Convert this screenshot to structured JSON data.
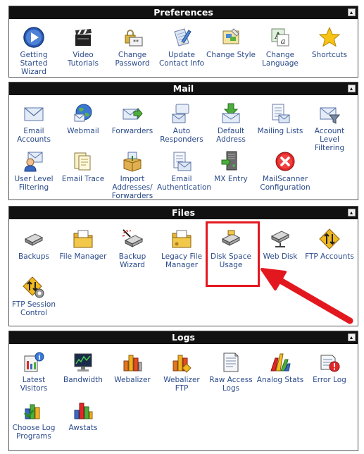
{
  "panels": {
    "preferences": {
      "title": "Preferences",
      "items": [
        {
          "label": "Getting Started Wizard",
          "icon": "play-icon"
        },
        {
          "label": "Video Tutorials",
          "icon": "clapperboard-icon"
        },
        {
          "label": "Change Password",
          "icon": "password-lock-icon"
        },
        {
          "label": "Update Contact Info",
          "icon": "contact-info-icon"
        },
        {
          "label": "Change Style",
          "icon": "style-palette-icon"
        },
        {
          "label": "Change Language",
          "icon": "language-icon"
        },
        {
          "label": "Shortcuts",
          "icon": "star-icon"
        }
      ]
    },
    "mail": {
      "title": "Mail",
      "items": [
        {
          "label": "Email Accounts",
          "icon": "envelope-icon"
        },
        {
          "label": "Webmail",
          "icon": "globe-mail-icon"
        },
        {
          "label": "Forwarders",
          "icon": "forward-mail-icon"
        },
        {
          "label": "Auto Responders",
          "icon": "auto-responder-icon"
        },
        {
          "label": "Default Address",
          "icon": "default-address-icon"
        },
        {
          "label": "Mailing Lists",
          "icon": "mailing-list-icon"
        },
        {
          "label": "Account Level Filtering",
          "icon": "account-filter-icon"
        },
        {
          "label": "User Level Filtering",
          "icon": "user-filter-icon"
        },
        {
          "label": "Email Trace",
          "icon": "email-trace-icon"
        },
        {
          "label": "Import Addresses/ Forwarders",
          "icon": "import-box-icon"
        },
        {
          "label": "Email Authentication",
          "icon": "email-auth-icon"
        },
        {
          "label": "MX Entry",
          "icon": "mx-entry-icon"
        },
        {
          "label": "MailScanner Configuration",
          "icon": "mailscanner-icon"
        }
      ]
    },
    "files": {
      "title": "Files",
      "items": [
        {
          "label": "Backups",
          "icon": "backup-drive-icon"
        },
        {
          "label": "File Manager",
          "icon": "folder-icon"
        },
        {
          "label": "Backup Wizard",
          "icon": "backup-wizard-icon"
        },
        {
          "label": "Legacy File Manager",
          "icon": "legacy-folder-icon"
        },
        {
          "label": "Disk Space Usage",
          "icon": "disk-usage-icon"
        },
        {
          "label": "Web Disk",
          "icon": "web-disk-icon"
        },
        {
          "label": "FTP Accounts",
          "icon": "ftp-accounts-icon"
        },
        {
          "label": "FTP Session Control",
          "icon": "ftp-session-icon"
        }
      ]
    },
    "logs": {
      "title": "Logs",
      "items": [
        {
          "label": "Latest Visitors",
          "icon": "latest-visitors-icon"
        },
        {
          "label": "Bandwidth",
          "icon": "bandwidth-icon"
        },
        {
          "label": "Webalizer",
          "icon": "webalizer-icon"
        },
        {
          "label": "Webalizer FTP",
          "icon": "webalizer-ftp-icon"
        },
        {
          "label": "Raw Access Logs",
          "icon": "raw-logs-icon"
        },
        {
          "label": "Analog Stats",
          "icon": "analog-stats-icon"
        },
        {
          "label": "Error Log",
          "icon": "error-log-icon"
        },
        {
          "label": "Choose Log Programs",
          "icon": "choose-log-icon"
        },
        {
          "label": "Awstats",
          "icon": "awstats-icon"
        }
      ]
    }
  },
  "annotation": {
    "highlight_target": "Disk Space Usage",
    "color": "#e3181f"
  },
  "colors": {
    "header_bg": "#111111",
    "label_text": "#2a4a8a"
  }
}
